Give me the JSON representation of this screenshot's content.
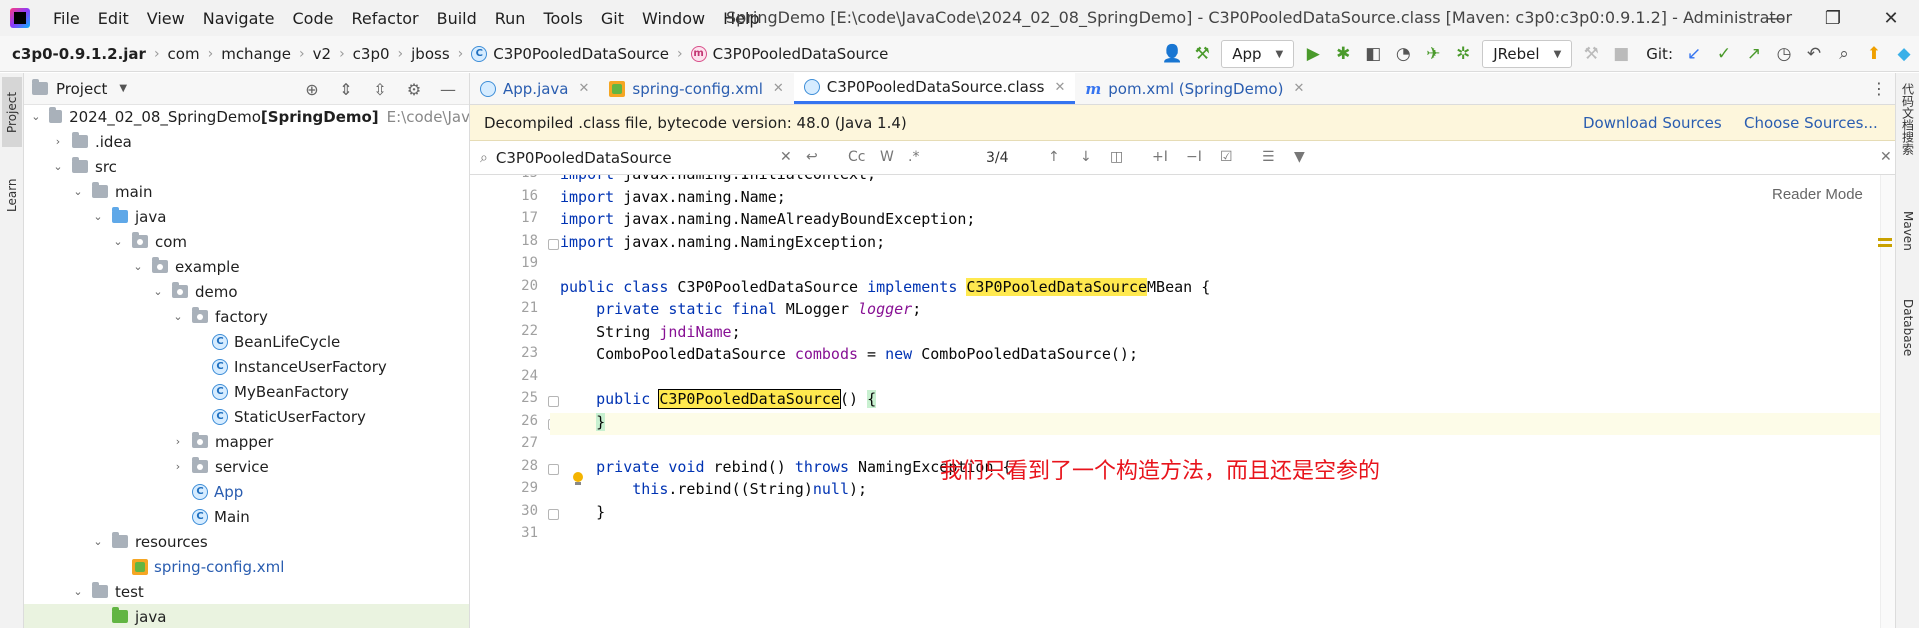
{
  "menu": [
    "File",
    "Edit",
    "View",
    "Navigate",
    "Code",
    "Refactor",
    "Build",
    "Run",
    "Tools",
    "Git",
    "Window",
    "Help"
  ],
  "window_title": "SpringDemo [E:\\code\\JavaCode\\2024_02_08_SpringDemo] - C3P0PooledDataSource.class [Maven: c3p0:c3p0:0.9.1.2] - Administrator",
  "breadcrumb": {
    "jar": "c3p0-0.9.1.2.jar",
    "parts": [
      "com",
      "mchange",
      "v2",
      "c3p0",
      "jboss"
    ],
    "class": "C3P0PooledDataSource",
    "member": "C3P0PooledDataSource"
  },
  "toolbar": {
    "run_config": "App",
    "jrebel": "JRebel",
    "git_label": "Git:"
  },
  "project_panel": {
    "title": "Project",
    "tree": [
      {
        "label": "2024_02_08_SpringDemo",
        "bold_suffix": "[SpringDemo]",
        "path": "E:\\code\\Jav",
        "indent": 0,
        "twisty": "open",
        "icon": "proj"
      },
      {
        "label": ".idea",
        "indent": 1,
        "twisty": "closed",
        "icon": "folder"
      },
      {
        "label": "src",
        "indent": 1,
        "twisty": "open",
        "icon": "folder"
      },
      {
        "label": "main",
        "indent": 2,
        "twisty": "open",
        "icon": "folder"
      },
      {
        "label": "java",
        "indent": 3,
        "twisty": "open",
        "icon": "blue"
      },
      {
        "label": "com",
        "indent": 4,
        "twisty": "open",
        "icon": "pkg"
      },
      {
        "label": "example",
        "indent": 5,
        "twisty": "open",
        "icon": "pkg"
      },
      {
        "label": "demo",
        "indent": 6,
        "twisty": "open",
        "icon": "pkg"
      },
      {
        "label": "factory",
        "indent": 7,
        "twisty": "open",
        "icon": "pkg"
      },
      {
        "label": "BeanLifeCycle",
        "indent": 8,
        "twisty": "none",
        "icon": "class"
      },
      {
        "label": "InstanceUserFactory",
        "indent": 8,
        "twisty": "none",
        "icon": "class"
      },
      {
        "label": "MyBeanFactory",
        "indent": 8,
        "twisty": "none",
        "icon": "class"
      },
      {
        "label": "StaticUserFactory",
        "indent": 8,
        "twisty": "none",
        "icon": "class"
      },
      {
        "label": "mapper",
        "indent": 7,
        "twisty": "closed",
        "icon": "pkg"
      },
      {
        "label": "service",
        "indent": 7,
        "twisty": "closed",
        "icon": "pkg"
      },
      {
        "label": "App",
        "indent": 7,
        "twisty": "none",
        "icon": "runclass",
        "link": true
      },
      {
        "label": "Main",
        "indent": 7,
        "twisty": "none",
        "icon": "runclass"
      },
      {
        "label": "resources",
        "indent": 3,
        "twisty": "open",
        "icon": "res"
      },
      {
        "label": "spring-config.xml",
        "indent": 4,
        "twisty": "none",
        "icon": "xml",
        "link": true
      },
      {
        "label": "test",
        "indent": 2,
        "twisty": "open",
        "icon": "folder"
      },
      {
        "label": "java",
        "indent": 3,
        "twisty": "none",
        "icon": "green",
        "selected": true
      }
    ]
  },
  "editor_tabs": [
    {
      "label": "App.java",
      "icon": "java",
      "link": true
    },
    {
      "label": "spring-config.xml",
      "icon": "xml",
      "link": true
    },
    {
      "label": "C3P0PooledDataSource.class",
      "icon": "java",
      "active": true
    },
    {
      "label": "pom.xml (SpringDemo)",
      "icon": "mvn",
      "link": true
    }
  ],
  "banner": {
    "message": "Decompiled .class file, bytecode version: 48.0 (Java 1.4)",
    "download": "Download Sources",
    "choose": "Choose Sources..."
  },
  "search": {
    "query": "C3P0PooledDataSource",
    "count": "3/4"
  },
  "reader_mode": "Reader Mode",
  "code_lines": [
    {
      "n": "15",
      "text": "import javax.naming.InitialContext;"
    },
    {
      "n": "16",
      "text": "import javax.naming.Name;"
    },
    {
      "n": "17",
      "text": "import javax.naming.NameAlreadyBoundException;"
    },
    {
      "n": "18",
      "text": "import javax.naming.NamingException;"
    },
    {
      "n": "19",
      "text": ""
    },
    {
      "n": "20",
      "text": "public class C3P0PooledDataSource implements C3P0PooledDataSourceMBean {"
    },
    {
      "n": "21",
      "text": "    private static final MLogger logger;"
    },
    {
      "n": "22",
      "text": "    String jndiName;"
    },
    {
      "n": "23",
      "text": "    ComboPooledDataSource combods = new ComboPooledDataSource();"
    },
    {
      "n": "24",
      "text": ""
    },
    {
      "n": "25",
      "text": "    public C3P0PooledDataSource() {"
    },
    {
      "n": "26",
      "text": "    }"
    },
    {
      "n": "27",
      "text": ""
    },
    {
      "n": "28",
      "text": "    private void rebind() throws NamingException {"
    },
    {
      "n": "29",
      "text": "        this.rebind((String)null);"
    },
    {
      "n": "30",
      "text": "    }"
    },
    {
      "n": "31",
      "text": ""
    }
  ],
  "annotation": "我们只看到了一个构造方法，而且还是空参的",
  "right_stripe": [
    "代码文档搜索",
    "Maven",
    "Database"
  ],
  "left_stripe": [
    "Project",
    "Learn"
  ],
  "colors": {
    "keyword": "#0033b3",
    "field": "#871094",
    "match": "#ffe94f",
    "annotation": "#e8141c",
    "accent": "#3574f0"
  }
}
